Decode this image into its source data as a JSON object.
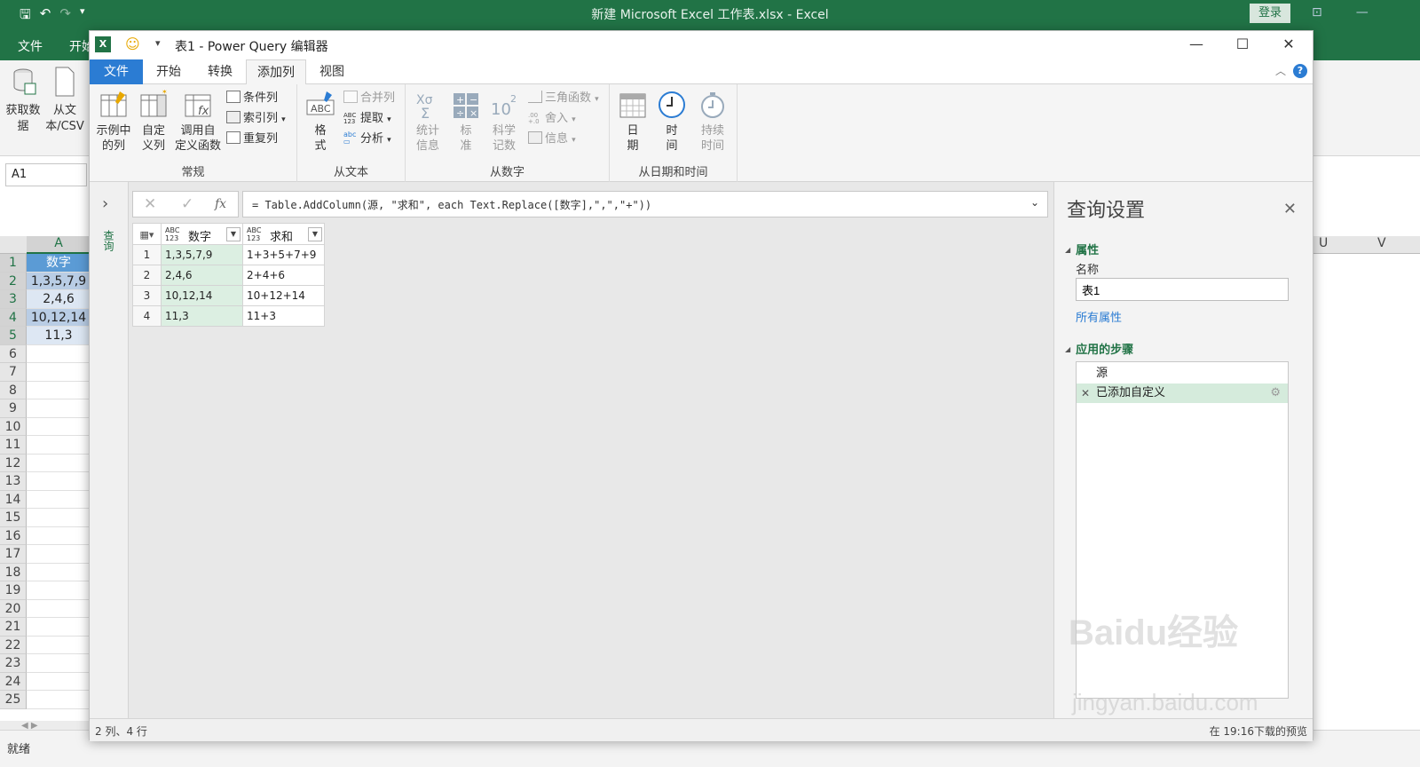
{
  "excel": {
    "window_title": "新建 Microsoft Excel 工作表.xlsx - Excel",
    "login_button": "登录",
    "tabs": [
      "文件",
      "开始"
    ],
    "ribbon": {
      "get_data": "获取数\n据",
      "from_csv": "从文\n本/CSV"
    },
    "name_box": "A1",
    "column_a": "A",
    "right_columns": [
      "U",
      "V"
    ],
    "row_numbers": [
      "1",
      "2",
      "3",
      "4",
      "5",
      "6",
      "7",
      "8",
      "9",
      "10",
      "11",
      "12",
      "13",
      "14",
      "15",
      "16",
      "17",
      "18",
      "19",
      "20",
      "21",
      "22",
      "23",
      "24",
      "25"
    ],
    "cells": [
      "数字",
      "1,3,5,7,9",
      "2,4,6",
      "10,12,14",
      "11,3"
    ],
    "status_ready": "就绪"
  },
  "pq": {
    "title": "表1 - Power Query 编辑器",
    "tabs": [
      "文件",
      "开始",
      "转换",
      "添加列",
      "视图"
    ],
    "active_tab": "添加列",
    "ribbon": {
      "general": {
        "label": "常规",
        "column_from_examples": "示例中\n的列",
        "custom_column": "自定\n义列",
        "invoke_custom_function": "调用自\n定义函数",
        "conditional_column": "条件列",
        "index_column": "索引列",
        "duplicate_column": "重复列"
      },
      "from_text": {
        "label": "从文本",
        "format": "格\n式",
        "merge_columns": "合并列",
        "extract": "提取",
        "parse": "分析"
      },
      "from_number": {
        "label": "从数字",
        "statistics": "统计\n信息",
        "standard": "标\n准",
        "scientific": "科学\n记数",
        "trigonometry": "三角函数",
        "rounding": "舍入",
        "information": "信息"
      },
      "from_datetime": {
        "label": "从日期和时间",
        "date": "日\n期",
        "time": "时\n间",
        "duration": "持续\n时间"
      }
    },
    "nav_label": "查询",
    "formula": "= Table.AddColumn(源, \"求和\", each Text.Replace([数字],\",\",\"+\"))",
    "table": {
      "columns": [
        {
          "type": "ABC\n123",
          "name": "数字"
        },
        {
          "type": "ABC\n123",
          "name": "求和"
        }
      ],
      "rows": [
        [
          "1",
          "1,3,5,7,9",
          "1+3+5+7+9"
        ],
        [
          "2",
          "2,4,6",
          "2+4+6"
        ],
        [
          "3",
          "10,12,14",
          "10+12+14"
        ],
        [
          "4",
          "11,3",
          "11+3"
        ]
      ]
    },
    "settings": {
      "title": "查询设置",
      "properties_header": "属性",
      "name_label": "名称",
      "name_value": "表1",
      "all_properties": "所有属性",
      "steps_header": "应用的步骤",
      "steps": [
        "源",
        "已添加自定义"
      ]
    },
    "status_left": "2 列、4 行",
    "status_right": "在 19:16下载的预览"
  },
  "watermark": {
    "line1": "Baidu经验",
    "line2": "jingyan.baidu.com"
  },
  "colors": {
    "excel_green": "#217346",
    "pq_blue": "#2b7cd3",
    "column_highlight": "#dcefe2"
  }
}
